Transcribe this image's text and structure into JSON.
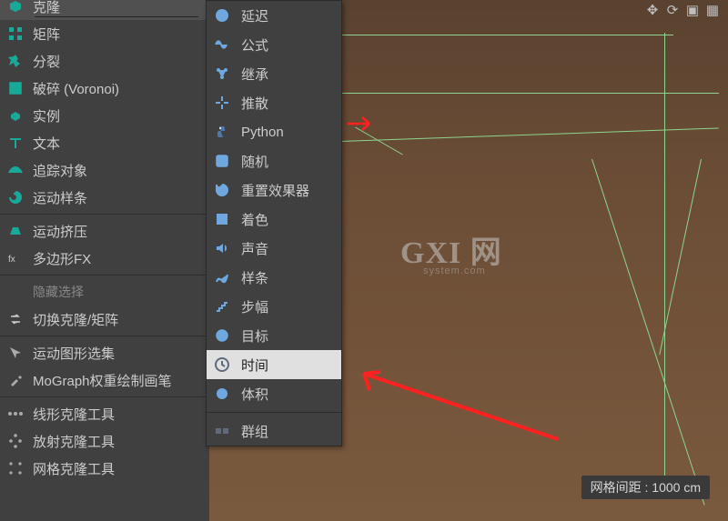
{
  "sidebar": {
    "items": [
      {
        "label": "克隆"
      },
      {
        "label": "矩阵"
      },
      {
        "label": "分裂"
      },
      {
        "label": "破碎 (Voronoi)"
      },
      {
        "label": "实例"
      },
      {
        "label": "文本"
      },
      {
        "label": "追踪对象"
      },
      {
        "label": "运动样条"
      },
      {
        "label": "运动挤压"
      },
      {
        "label": "多边形FX"
      },
      {
        "label": "隐藏选择"
      },
      {
        "label": "切换克隆/矩阵"
      },
      {
        "label": "运动图形选集"
      },
      {
        "label": "MoGraph权重绘制画笔"
      },
      {
        "label": "线形克隆工具"
      },
      {
        "label": "放射克隆工具"
      },
      {
        "label": "网格克隆工具"
      }
    ]
  },
  "submenu": {
    "items": [
      {
        "label": "延迟"
      },
      {
        "label": "公式"
      },
      {
        "label": "继承"
      },
      {
        "label": "推散"
      },
      {
        "label": "Python"
      },
      {
        "label": "随机"
      },
      {
        "label": "重置效果器"
      },
      {
        "label": "着色"
      },
      {
        "label": "声音"
      },
      {
        "label": "样条"
      },
      {
        "label": "步幅"
      },
      {
        "label": "目标"
      },
      {
        "label": "时间"
      },
      {
        "label": "体积"
      },
      {
        "label": "群组"
      }
    ]
  },
  "statusbar": {
    "grid_label": "网格间距 : 1000 cm"
  },
  "watermark": {
    "text": "GXI 网",
    "sub": "system.com"
  }
}
